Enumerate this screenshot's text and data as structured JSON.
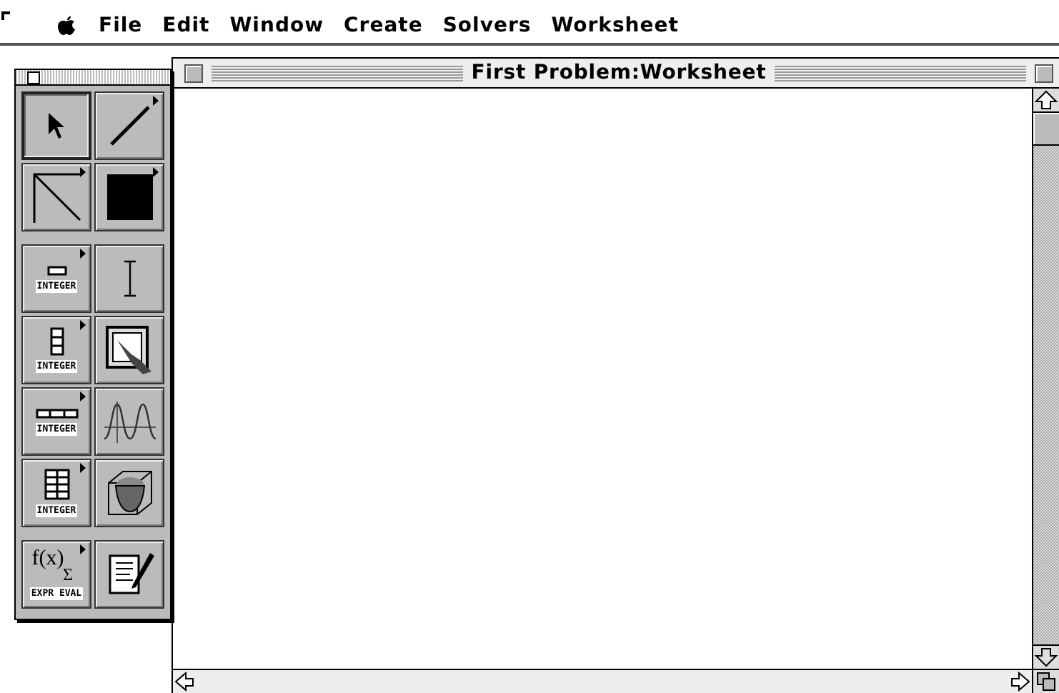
{
  "menu_bar": {
    "items": [
      "File",
      "Edit",
      "Window",
      "Create",
      "Solvers",
      "Worksheet"
    ]
  },
  "tool_palette": {
    "groups": [
      [
        {
          "kind": "arrow",
          "selected": true,
          "has_menu": false
        },
        {
          "kind": "line",
          "selected": false,
          "has_menu": true
        },
        {
          "kind": "corner-line",
          "selected": false,
          "has_menu": true
        },
        {
          "kind": "filled-square",
          "selected": false,
          "has_menu": true
        }
      ],
      [
        {
          "kind": "field",
          "label": "INTEGER",
          "selected": false,
          "has_menu": true
        },
        {
          "kind": "text",
          "selected": false,
          "has_menu": false
        },
        {
          "kind": "column",
          "label": "INTEGER",
          "selected": false,
          "has_menu": true
        },
        {
          "kind": "picture",
          "selected": false,
          "has_menu": false
        },
        {
          "kind": "row",
          "label": "INTEGER",
          "selected": false,
          "has_menu": true
        },
        {
          "kind": "graph",
          "selected": false,
          "has_menu": false
        },
        {
          "kind": "table",
          "label": "INTEGER",
          "selected": false,
          "has_menu": true
        },
        {
          "kind": "surface",
          "selected": false,
          "has_menu": false
        }
      ],
      [
        {
          "kind": "formula",
          "formula": "f(x)",
          "symbol": "Σ",
          "label": "EXPR EVAL",
          "selected": false,
          "has_menu": true
        },
        {
          "kind": "script",
          "selected": false,
          "has_menu": false
        }
      ]
    ]
  },
  "worksheet_window": {
    "title": "First Problem:Worksheet"
  }
}
